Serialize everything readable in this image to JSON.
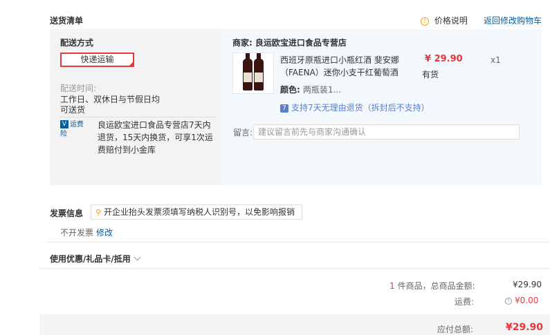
{
  "section": {
    "title": "送货清单",
    "price_note": "价格说明",
    "back_to_cart": "返回修改购物车"
  },
  "delivery": {
    "method_label": "配送方式",
    "method_value": "快递运输",
    "time_label": "配送时间:",
    "time_line1": "工作日、双休日与节假日均",
    "time_line2": "可送货",
    "insurance_badge": "运费险",
    "insurance_line1": "良运欧宝进口食品专营店7天内",
    "insurance_line2": "退货，15天内换货，可享1次运",
    "insurance_line3": "费赔付到小金库"
  },
  "shop": {
    "name_label": "商家:",
    "name": "良运欧宝进口食品专营店"
  },
  "product": {
    "title_line1": "西班牙原瓶进口小瓶红酒 斐安娜",
    "title_line2": "（FAENA）迷你小支干红葡萄酒",
    "price": "¥ 29.90",
    "stock": "有货",
    "quantity": "x1",
    "color_label": "颜色:",
    "color_value": "两瓶装1...",
    "return_policy": "支持7天无理由退货（拆封后不支持）"
  },
  "note": {
    "label": "留言:",
    "placeholder": "建议留言前先与商家沟通确认"
  },
  "invoice": {
    "title": "发票信息",
    "tip": "开企业抬头发票须填写纳税人识别号，以免影响报销",
    "value": "不开发票",
    "modify": "修改"
  },
  "discount": {
    "title": "使用优惠/礼品卡/抵用"
  },
  "summary": {
    "count": "1",
    "count_text": "件商品，总商品金额:",
    "goods_total": "¥29.90",
    "shipping_label": "运费:",
    "shipping_value": "¥0.00",
    "payable_label": "应付总额:",
    "payable_value": "¥29.90"
  },
  "colors": {
    "accent_red": "#e4393c",
    "link_blue": "#005ea7",
    "right_panel_bg": "#f3f8fd",
    "left_panel_bg": "#f3f3f3"
  }
}
